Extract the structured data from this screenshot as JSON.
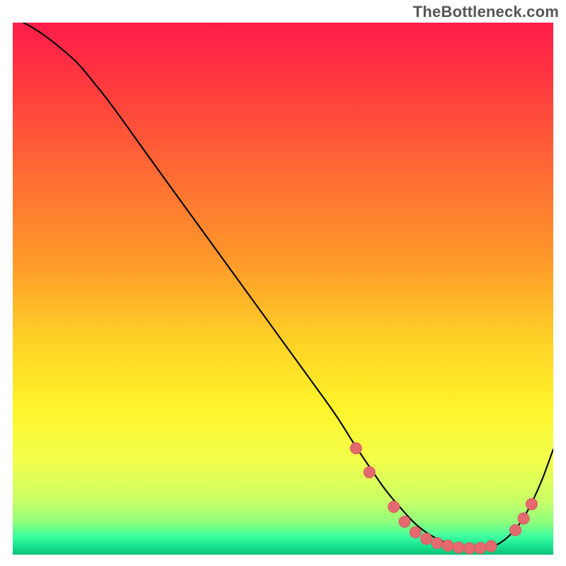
{
  "attribution": "TheBottleneck.com",
  "chart_data": {
    "type": "line",
    "title": "",
    "xlabel": "",
    "ylabel": "",
    "xlim": [
      0,
      100
    ],
    "ylim": [
      0,
      100
    ],
    "grid": false,
    "legend": false,
    "background": {
      "type": "vertical_gradient",
      "stops": [
        {
          "offset": 0.0,
          "color": "#ff1c49"
        },
        {
          "offset": 0.12,
          "color": "#ff3b3e"
        },
        {
          "offset": 0.28,
          "color": "#ff6a34"
        },
        {
          "offset": 0.45,
          "color": "#ff9a2a"
        },
        {
          "offset": 0.6,
          "color": "#ffd226"
        },
        {
          "offset": 0.72,
          "color": "#fff32a"
        },
        {
          "offset": 0.82,
          "color": "#f3ff4a"
        },
        {
          "offset": 0.9,
          "color": "#c8ff66"
        },
        {
          "offset": 0.94,
          "color": "#8cff7c"
        },
        {
          "offset": 0.965,
          "color": "#3fffa0"
        },
        {
          "offset": 0.985,
          "color": "#16e18f"
        },
        {
          "offset": 1.0,
          "color": "#0fbf78"
        }
      ]
    },
    "series": [
      {
        "name": "curve",
        "stroke": "#000000",
        "stroke_width": 2.1,
        "x": [
          0,
          4,
          8,
          12,
          14,
          18,
          25,
          35,
          45,
          55,
          60,
          63,
          66,
          69,
          72,
          74,
          76,
          78,
          80,
          82,
          84,
          86,
          88,
          90,
          92,
          94,
          96,
          98,
          99,
          100
        ],
        "y": [
          101,
          99,
          96,
          92.5,
          90,
          85,
          75,
          61,
          47,
          33,
          26,
          21,
          16.5,
          12,
          8.5,
          6.2,
          4.5,
          3.2,
          2.3,
          1.6,
          1.2,
          1.1,
          1.3,
          2.0,
          3.6,
          6.0,
          9.6,
          14.2,
          17.0,
          19.8
        ]
      }
    ],
    "markers": {
      "name": "dots",
      "shape": "circle",
      "radius": 8,
      "fill": "#e46a70",
      "stroke": "#d65a62",
      "stroke_width": 1,
      "points": [
        {
          "x": 63.5,
          "y": 20.0
        },
        {
          "x": 66.0,
          "y": 15.5
        },
        {
          "x": 70.5,
          "y": 9.0
        },
        {
          "x": 72.5,
          "y": 6.2
        },
        {
          "x": 74.5,
          "y": 4.2
        },
        {
          "x": 76.5,
          "y": 3.0
        },
        {
          "x": 78.5,
          "y": 2.2
        },
        {
          "x": 80.5,
          "y": 1.7
        },
        {
          "x": 82.5,
          "y": 1.35
        },
        {
          "x": 84.5,
          "y": 1.2
        },
        {
          "x": 86.5,
          "y": 1.25
        },
        {
          "x": 88.5,
          "y": 1.6
        },
        {
          "x": 93.0,
          "y": 4.6
        },
        {
          "x": 94.5,
          "y": 6.8
        },
        {
          "x": 96.0,
          "y": 9.5
        }
      ]
    }
  }
}
